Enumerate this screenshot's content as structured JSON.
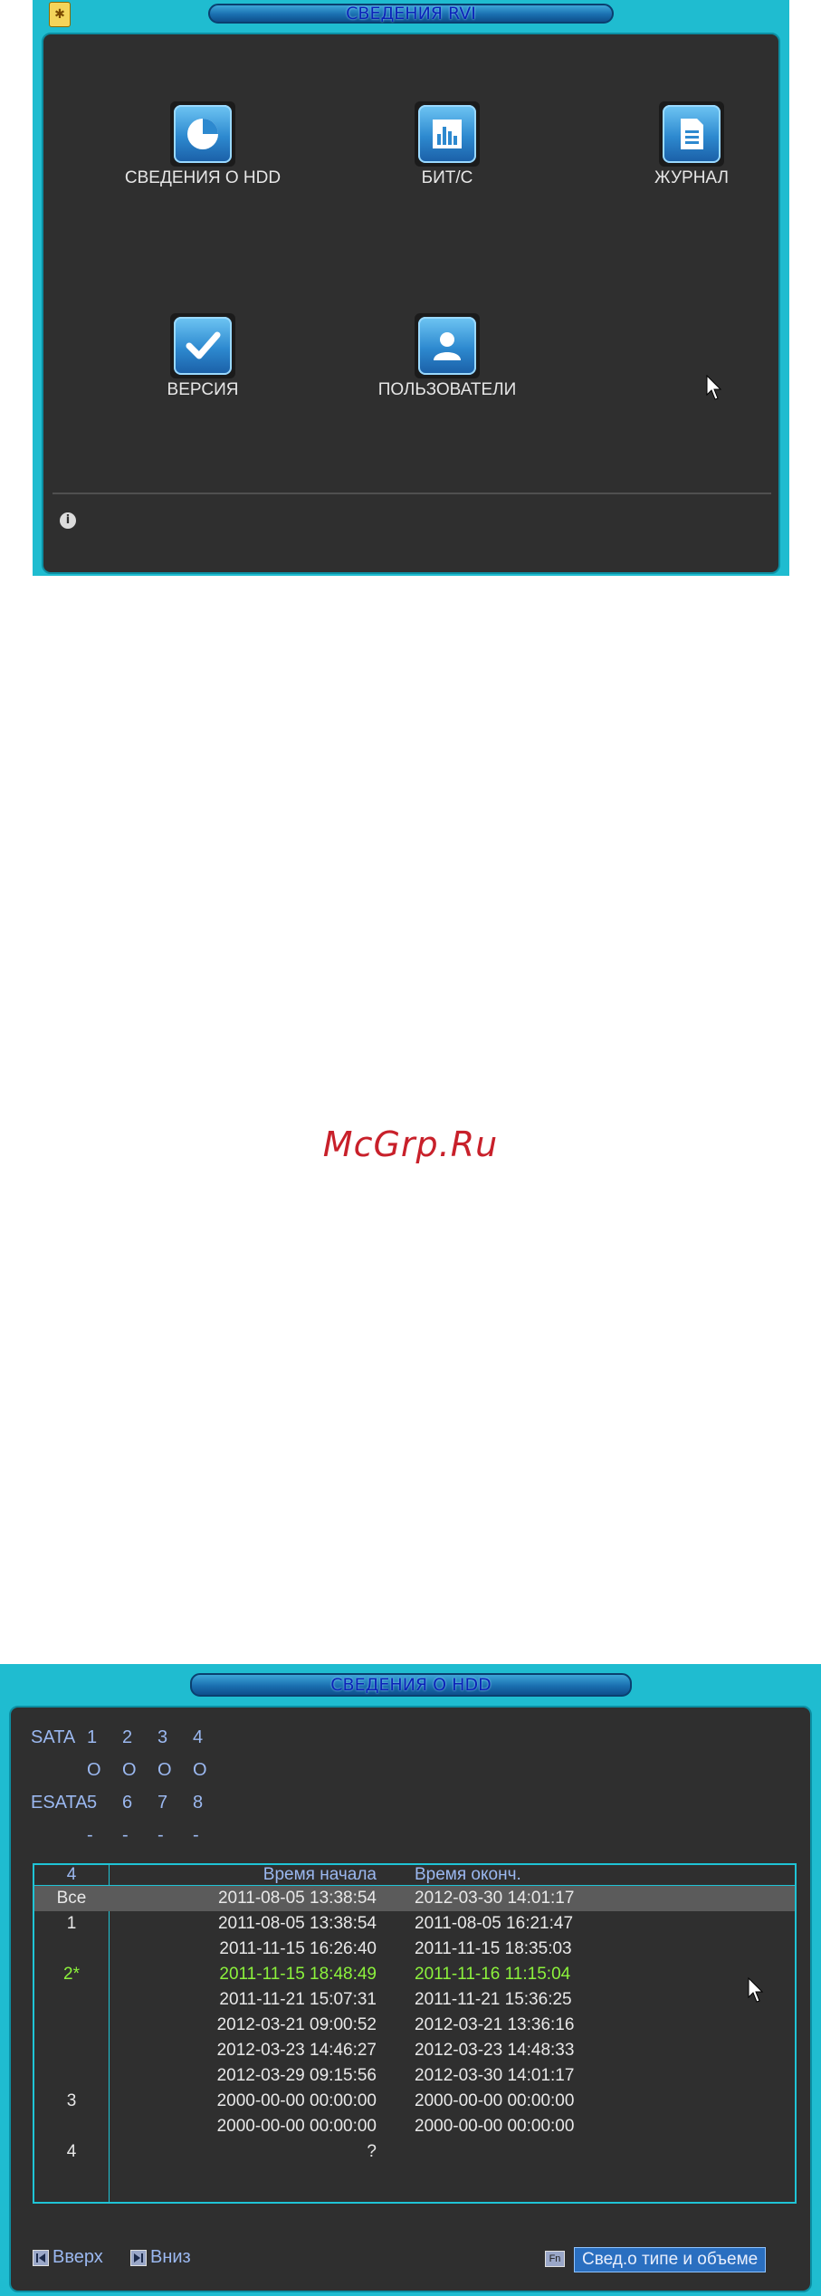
{
  "window1": {
    "title": "СВЕДЕНИЯ RVI",
    "tiles": [
      {
        "label": "СВЕДЕНИЯ О HDD",
        "icon": "pie-chart-icon"
      },
      {
        "label": "БИТ/С",
        "icon": "bar-chart-icon"
      },
      {
        "label": "ЖУРНАЛ",
        "icon": "document-icon"
      },
      {
        "label": "ВЕРСИЯ",
        "icon": "checkmark-icon"
      },
      {
        "label": "ПОЛЬЗОВАТЕЛИ",
        "icon": "user-icon"
      }
    ],
    "info_icon": "info-icon"
  },
  "watermark": "McGrp.Ru",
  "window2": {
    "title": "СВЕДЕНИЯ О HDD",
    "sata_label": "SATA",
    "sata_ports": [
      "1",
      "2",
      "3",
      "4"
    ],
    "sata_status": [
      "O",
      "O",
      "O",
      "O"
    ],
    "esata_label": "ESATA",
    "esata_ports": [
      "5",
      "6",
      "7",
      "8"
    ],
    "esata_status": [
      "-",
      "-",
      "-",
      "-"
    ],
    "table": {
      "headers": [
        "4",
        "Время начала",
        "Время оконч."
      ],
      "rows": [
        {
          "disk": "Все",
          "start": "2011-08-05 13:38:54",
          "end": "2012-03-30 14:01:17",
          "state": "selected"
        },
        {
          "disk": "1",
          "start": "2011-08-05 13:38:54",
          "end": "2011-08-05 16:21:47",
          "state": ""
        },
        {
          "disk": "",
          "start": "2011-11-15 16:26:40",
          "end": "2011-11-15 18:35:03",
          "state": ""
        },
        {
          "disk": "2*",
          "start": "2011-11-15 18:48:49",
          "end": "2011-11-16 11:15:04",
          "state": "current"
        },
        {
          "disk": "",
          "start": "2011-11-21 15:07:31",
          "end": "2011-11-21 15:36:25",
          "state": ""
        },
        {
          "disk": "",
          "start": "2012-03-21 09:00:52",
          "end": "2012-03-21 13:36:16",
          "state": ""
        },
        {
          "disk": "",
          "start": "2012-03-23 14:46:27",
          "end": "2012-03-23 14:48:33",
          "state": ""
        },
        {
          "disk": "",
          "start": "2012-03-29 09:15:56",
          "end": "2012-03-30 14:01:17",
          "state": ""
        },
        {
          "disk": "3",
          "start": "2000-00-00 00:00:00",
          "end": "2000-00-00 00:00:00",
          "state": ""
        },
        {
          "disk": "",
          "start": "2000-00-00 00:00:00",
          "end": "2000-00-00 00:00:00",
          "state": ""
        },
        {
          "disk": "4",
          "start": "?",
          "end": "",
          "state": ""
        }
      ]
    },
    "bottom": {
      "up_label": "Вверх",
      "down_label": "Вниз",
      "fn_label": "Fn",
      "type_button_label": "Свед.о типе и объеме"
    }
  },
  "colors": {
    "frame": "#1fbcd0",
    "panel": "#2f2f2f",
    "label_blue": "#9bb8f0",
    "current_green": "#8cf23c",
    "watermark_red": "#c8202a"
  }
}
